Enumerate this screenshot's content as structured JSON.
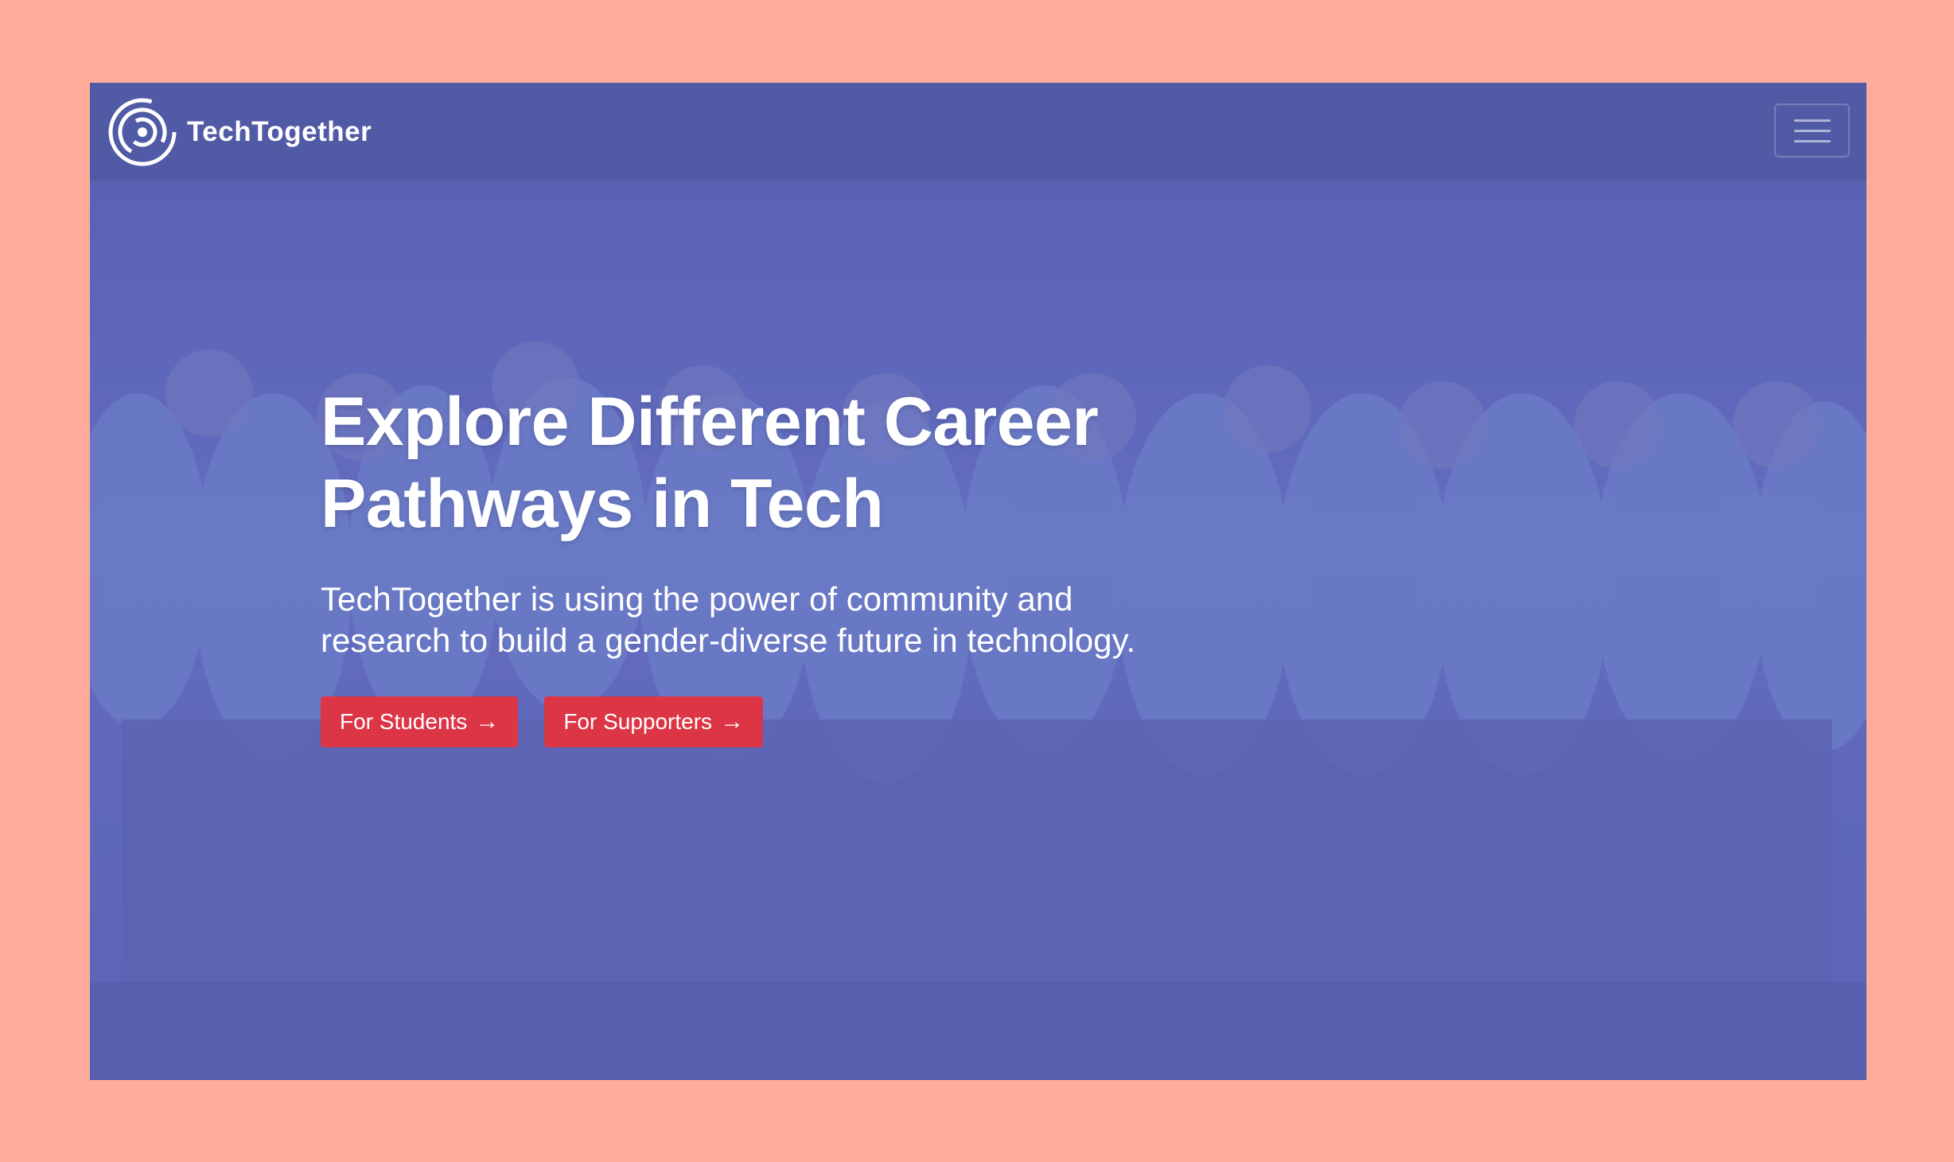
{
  "colors": {
    "page_background": "#FFAC9B",
    "hero_overlay": "#5C66BA",
    "button": "#DC3545",
    "text": "#FFFFFF"
  },
  "navbar": {
    "brand_name": "TechTogether",
    "logo_icon": "concentric-circles-logo-icon",
    "menu_icon": "hamburger-menu-icon"
  },
  "hero": {
    "background_image": "group of smiling women in light blue sweatshirts cheering on stage",
    "heading": "Explore Different Career Pathways in Tech",
    "subheading": "TechTogether is using the power of community and research to build a gender-diverse future in technology.",
    "buttons": [
      {
        "label": "For Students",
        "icon": "arrow-right-icon",
        "arrow": "→"
      },
      {
        "label": "For Supporters",
        "icon": "arrow-right-icon",
        "arrow": "→"
      }
    ]
  }
}
